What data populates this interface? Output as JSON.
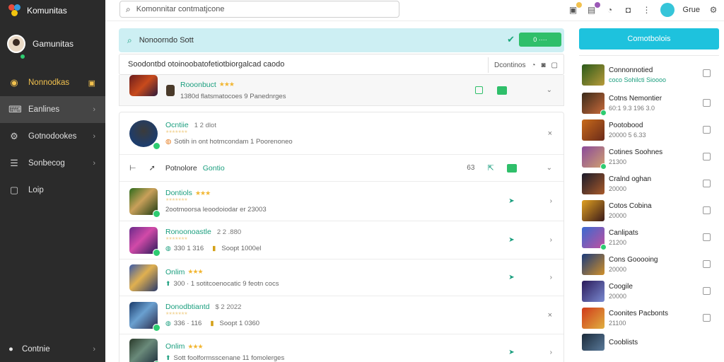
{
  "app": {
    "brand": "Komunitas"
  },
  "sidebar": {
    "profile_name": "Gamunitas",
    "items": [
      {
        "label": "Nonnodkas",
        "icon": "home-icon"
      },
      {
        "label": "Eanlines",
        "icon": "games-icon"
      },
      {
        "label": "Gotnodookes",
        "icon": "settings-icon"
      },
      {
        "label": "Sonbecog",
        "icon": "list-icon"
      },
      {
        "label": "Loip",
        "icon": "document-icon"
      }
    ],
    "footer_label": "Contnie"
  },
  "topbar": {
    "search_placeholder": "Komonnitar contmatjcone",
    "user": "Grue"
  },
  "filter": {
    "label": "Nonoorndo Sott",
    "button": "0 ····"
  },
  "header_row": {
    "text": "Soodontbd otoinoobatofetiotbiorgalcad caodo",
    "right_label": "Dcontinos"
  },
  "rows": [
    {
      "title": "Rooonbuct",
      "stars": "★★★",
      "sub": "1380d flatsmatocoes 9 Panednrges"
    },
    {
      "title": "Ocntiie",
      "num": "1 2 dlot",
      "stars_faint": "★★★★★★★",
      "sub": "Sotih in ont hotmcondam 1 Poorenoneo"
    },
    {
      "title": "Potnolore",
      "title2": "Gontio",
      "num": "63"
    },
    {
      "title": "Dontiols",
      "stars": "★★★",
      "stars_faint": "★★★★★★★",
      "sub": "2ootmoorsa leoodoiodar er 23003"
    },
    {
      "title": "Ronoonoastle",
      "num": "2 2 .880",
      "stars_faint": "★★★★★★★",
      "sub": "330 1 316",
      "sub2": "Soopt 1000el"
    },
    {
      "title": "Onlim",
      "stars": "★★★",
      "sub": "300 · 1 sotitcoenocatic 9 feotn cocs"
    },
    {
      "title": "Donodbtiantd",
      "num": "$ 2 2022",
      "stars_faint": "★★★★★★★",
      "sub": "336 · 116",
      "sub2": "Soopt 1 0360"
    },
    {
      "title": "Onlim",
      "stars": "★★★",
      "sub": "Sott foolformsscenane 11 fomolerges"
    }
  ],
  "right_panel": {
    "button": "Comotbolois",
    "items": [
      {
        "title": "Connonnotied",
        "sub": "coco  Sohilcti Sioooo"
      },
      {
        "title": "Cotns Nemontier",
        "sub": "60:1 9.3 196 3.0"
      },
      {
        "title": "Pootobood",
        "sub": "20000 5 6.33"
      },
      {
        "title": "Cotines Soohnes",
        "sub": "21300"
      },
      {
        "title": "Cralnd oghan",
        "sub": "20000"
      },
      {
        "title": "Cotos Cobina",
        "sub": "20000"
      },
      {
        "title": "Canlipats",
        "sub": "21200"
      },
      {
        "title": "Cons Gooooing",
        "sub": "20000"
      },
      {
        "title": "Coogile",
        "sub": "20000"
      },
      {
        "title": "Coonites Pacbonts",
        "sub": "21100"
      },
      {
        "title": "Cooblists",
        "sub": ""
      }
    ]
  },
  "colors": {
    "accent": "#1ec2dd",
    "green": "#2fbf6a",
    "teal_text": "#1a9e7e",
    "sidebar": "#2b2b2b"
  }
}
